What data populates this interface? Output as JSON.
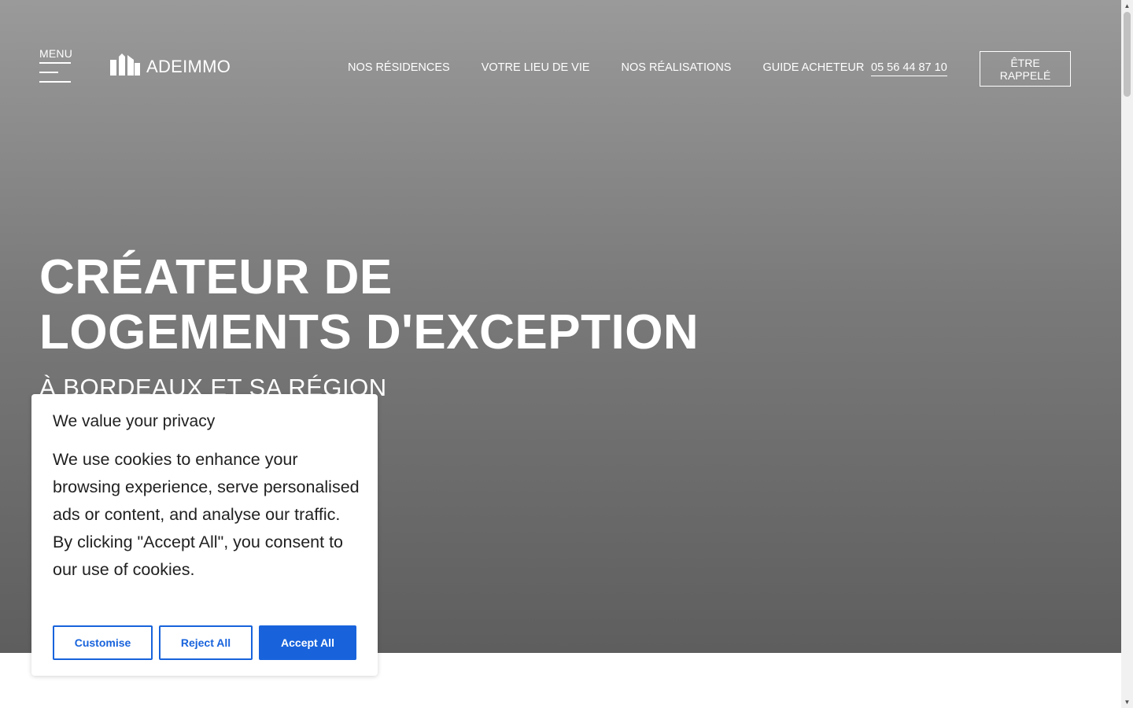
{
  "header": {
    "menu_label": "MENU",
    "logo_text": "ADEIMMO",
    "nav": [
      {
        "label": "NOS RÉSIDENCES"
      },
      {
        "label": "VOTRE LIEU DE VIE"
      },
      {
        "label": "NOS RÉALISATIONS"
      },
      {
        "label": "GUIDE ACHETEUR"
      }
    ],
    "phone": "05 56 44 87 10",
    "callback_label": "ÊTRE RAPPELÉ"
  },
  "hero": {
    "title_line1": "CRÉATEUR DE",
    "title_line2": "LOGEMENTS D'EXCEPTION",
    "subtitle": "À BORDEAUX ET SA RÉGION"
  },
  "cookie_banner": {
    "title": "We value your privacy",
    "body": "We use cookies to enhance your browsing experience, serve personalised ads or content, and analyse our traffic. By clicking \"Accept All\", you consent to our use of cookies.",
    "buttons": {
      "customise": "Customise",
      "reject": "Reject All",
      "accept": "Accept All"
    }
  },
  "colors": {
    "accent": "#1863dc",
    "hero_top": "#9a9a9a",
    "hero_bottom": "#5e5e5e"
  },
  "icons": {
    "menu": "hamburger-icon",
    "logo": "buildings-logo-icon",
    "scroll_up": "triangle-up-icon",
    "scroll_down": "triangle-down-icon"
  }
}
